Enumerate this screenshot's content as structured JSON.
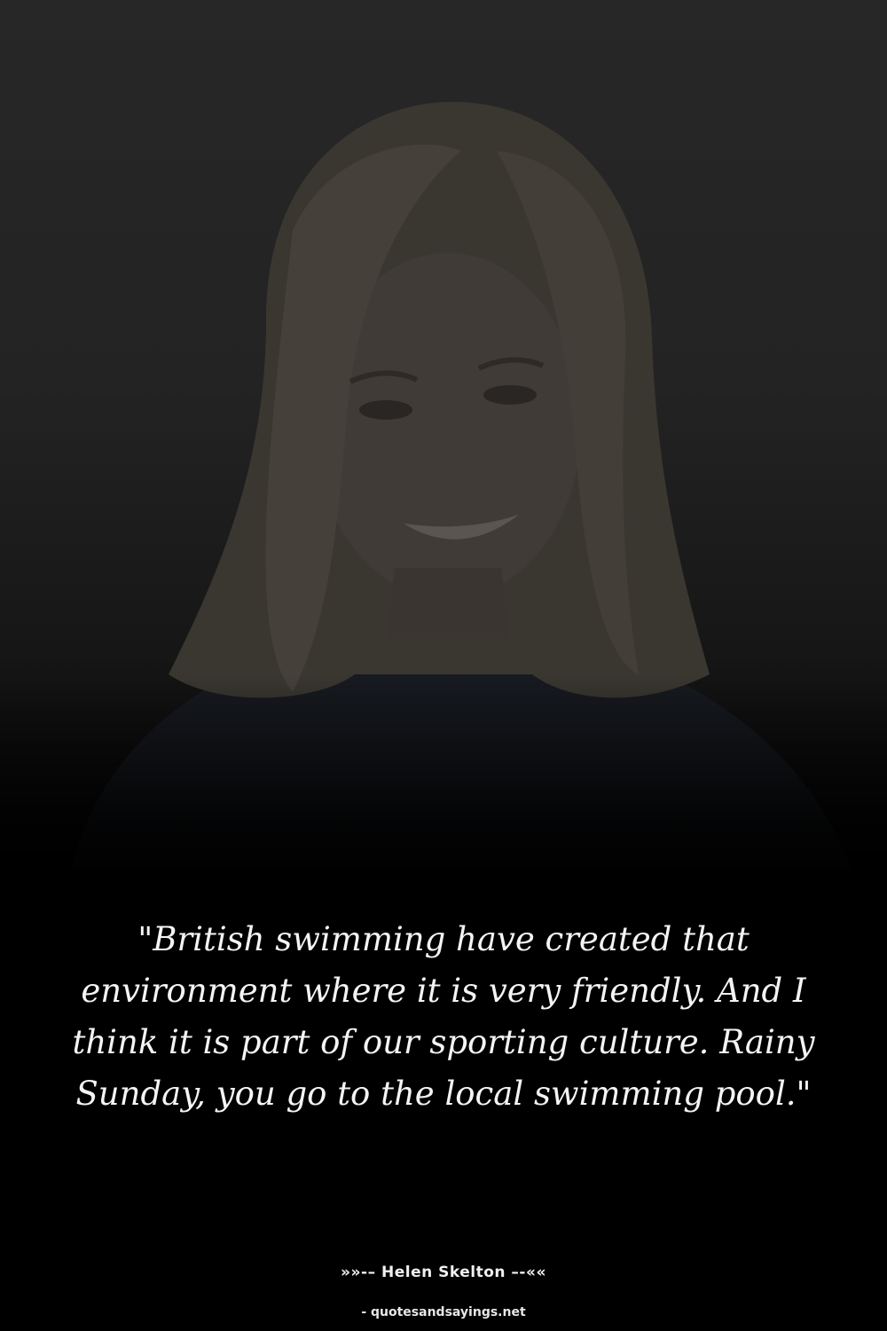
{
  "photo": {
    "alt_icon": "portrait-photo"
  },
  "quote": {
    "text": "\"British swimming have created that environment where it is very friendly. And I think it is part of our sporting culture. Rainy Sunday, you go to the local swimming pool.\""
  },
  "author": {
    "prefix": "»»-– ",
    "name": "Helen Skelton",
    "suffix": " –-««"
  },
  "source": {
    "site": "- quotesandsayings.net"
  },
  "colors": {
    "background": "#000000",
    "text": "#f4f4f4"
  }
}
